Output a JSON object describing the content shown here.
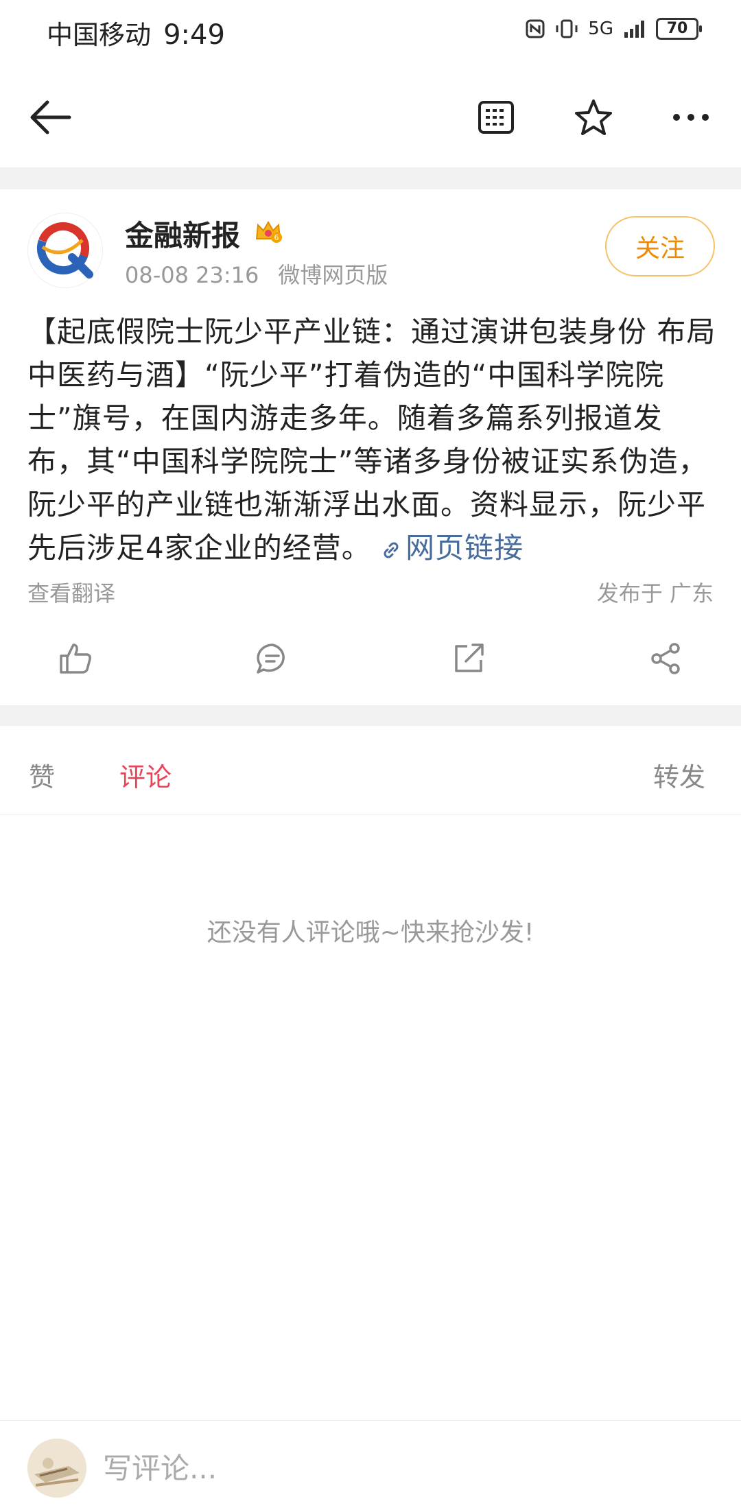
{
  "status_bar": {
    "carrier": "中国移动",
    "time": "9:49",
    "network": "5G",
    "battery": "70"
  },
  "nav": {
    "back_icon": "arrow-left-icon",
    "article_icon": "article-icon",
    "star_icon": "star-icon",
    "more_icon": "more-icon"
  },
  "post": {
    "author": "金融新报",
    "badge_icon": "crown-icon",
    "badge_level": "6",
    "date": "08-08 23:16",
    "source": "微博网页版",
    "follow_label": "关注",
    "text": "【起底假院士阮少平产业链：通过演讲包装身份 布局中医药与酒】“阮少平”打着伪造的“中国科学院院士”旗号，在国内游走多年。随着多篇系列报道发布，其“中国科学院院士”等诸多身份被证实系伪造，阮少平的产业链也渐渐浮出水面。资料显示，阮少平先后涉足4家企业的经营。",
    "link_label": "网页链接",
    "translate_label": "查看翻译",
    "location_label": "发布于 广东"
  },
  "actions": {
    "like_icon": "thumbs-up-icon",
    "comment_icon": "comment-icon",
    "repost_icon": "repost-icon",
    "share_icon": "share-icon"
  },
  "tabs": {
    "like": "赞",
    "comment": "评论",
    "repost": "转发"
  },
  "empty_tip": "还没有人评论哦~快来抢沙发!",
  "comment_bar": {
    "placeholder": "写评论..."
  },
  "colors": {
    "accent": "#e8445a",
    "follow": "#f08a00",
    "link": "#486b9e"
  }
}
